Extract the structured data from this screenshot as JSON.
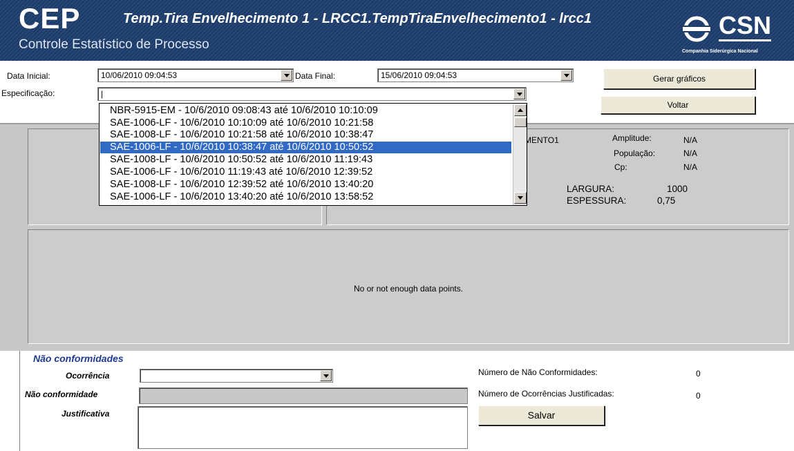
{
  "header": {
    "app_abbrev": "CEP",
    "app_name": "Controle Estatístico de Processo",
    "chart_title": "Temp.Tira Envelhecimento 1 - LRCC1.TempTiraEnvelhecimento1 - lrcc1",
    "logo_text": "CSN",
    "logo_caption": "Companhia Siderúrgica Nacional"
  },
  "filters": {
    "start_label": "Data Inicial:",
    "start_value": "10/06/2010 09:04:53",
    "end_label": "Data Final:",
    "end_value": "15/06/2010 09:04:53",
    "spec_label": "Especificação:",
    "spec_value": "|"
  },
  "buttons": {
    "generate": "Gerar gráficos",
    "back": "Voltar",
    "save": "Salvar"
  },
  "spec_dropdown": {
    "items": [
      "NBR-5915-EM - 10/6/2010 09:08:43 até 10/6/2010 10:10:09",
      "SAE-1006-LF - 10/6/2010 10:10:09 até 10/6/2010 10:21:58",
      "SAE-1008-LF - 10/6/2010 10:21:58 até 10/6/2010 10:38:47",
      "SAE-1006-LF - 10/6/2010 10:38:47 até 10/6/2010 10:50:52",
      "SAE-1008-LF - 10/6/2010 10:50:52 até 10/6/2010 11:19:43",
      "SAE-1006-LF - 10/6/2010 11:19:43 até 10/6/2010 12:39:52",
      "SAE-1008-LF - 10/6/2010 12:39:52 até 10/6/2010 13:40:20",
      "SAE-1006-LF - 10/6/2010 13:40:20 até 10/6/2010 13:58:52"
    ],
    "selected_index": 3
  },
  "stats": {
    "series_name_partial": "MENTO1",
    "amplitude_label": "Amplitude:",
    "amplitude_value": "N/A",
    "population_label": "População:",
    "population_value": "N/A",
    "cp_label": "Cp:",
    "cp_value": "N/A",
    "width_label": "LARGURA:",
    "width_value": "1000",
    "thickness_label": "ESPESSURA:",
    "thickness_value": "0,75"
  },
  "chart_area": {
    "message": "No or not enough data points."
  },
  "nonconformity": {
    "title": "Não conformidades",
    "occurrence_label": "Ocorrência",
    "occurrence_value": "",
    "nc_label": "Não conformidade",
    "justification_label": "Justificativa",
    "count_label": "Número de Não Conformidades:",
    "count_value": "0",
    "justified_label": "Número de Ocorrências Justificadas:",
    "justified_value": "0"
  },
  "colors": {
    "banner": "#1c3d6e",
    "selection": "#316ac5",
    "section_title": "#1f3a93"
  }
}
